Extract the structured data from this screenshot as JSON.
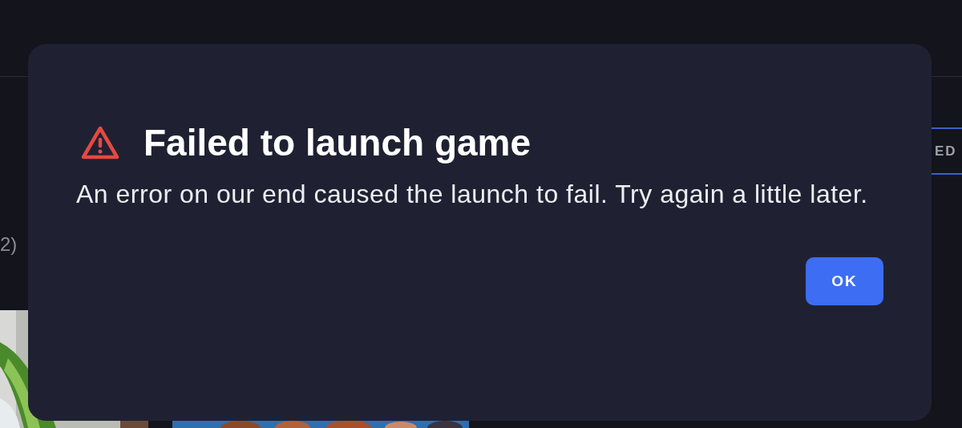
{
  "background": {
    "count_fragment": "2)",
    "tab_fragment": "ED"
  },
  "dialog": {
    "title": "Failed to launch game",
    "message": "An error on our end caused the launch to fail. Try again a little later.",
    "buttons": [
      "OK"
    ]
  }
}
